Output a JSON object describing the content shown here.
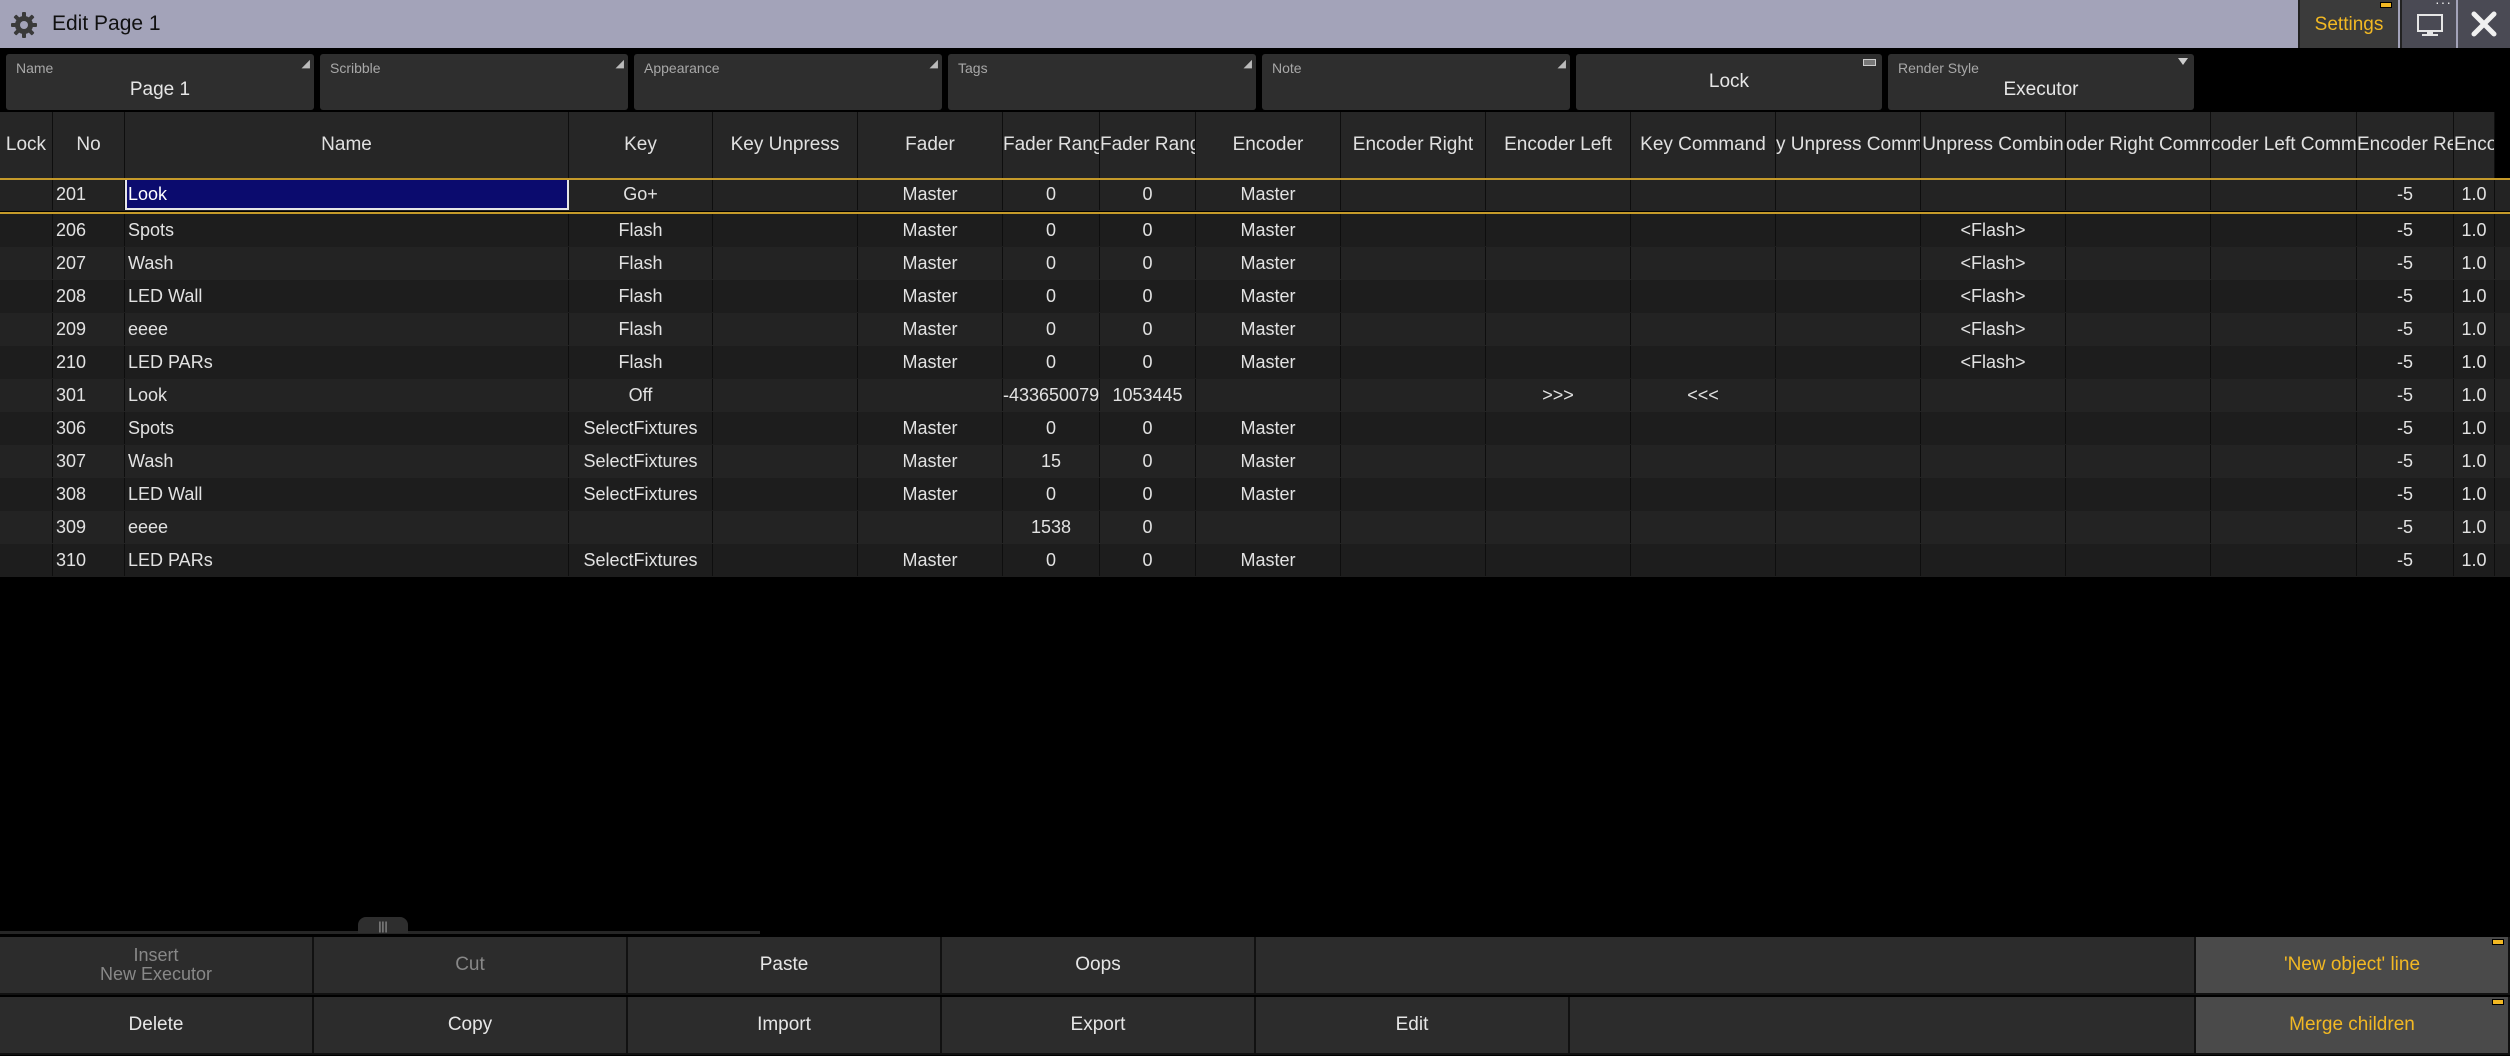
{
  "window": {
    "title": "Edit Page 1",
    "settings_label": "Settings"
  },
  "fields": [
    {
      "label": "Name",
      "value": "Page 1"
    },
    {
      "label": "Scribble",
      "value": ""
    },
    {
      "label": "Appearance",
      "value": ""
    },
    {
      "label": "Tags",
      "value": ""
    },
    {
      "label": "Note",
      "value": ""
    },
    {
      "label": "",
      "value": "Lock"
    },
    {
      "label": "Render Style",
      "value": "Executor"
    }
  ],
  "table": {
    "columns": [
      "Lock",
      "No",
      "Name",
      "Key",
      "Key Unpress",
      "Fader",
      "Fader Range",
      "Fader Range",
      "Encoder",
      "Encoder Right",
      "Encoder Left",
      "Key Command",
      "y Unpress Comma",
      "Unpress Combin",
      "oder Right Comm",
      "coder Left Comma",
      "Encoder Res",
      "Encode"
    ],
    "rows": [
      [
        "",
        "201",
        "Look",
        "Go+",
        "",
        "Master",
        "0",
        "0",
        "Master",
        "",
        "",
        "",
        "",
        "",
        "",
        "",
        "-5",
        "1.0"
      ],
      [
        "",
        "206",
        "Spots",
        "Flash",
        "",
        "Master",
        "0",
        "0",
        "Master",
        "",
        "",
        "",
        "",
        "<Flash>",
        "",
        "",
        "-5",
        "1.0"
      ],
      [
        "",
        "207",
        "Wash",
        "Flash",
        "",
        "Master",
        "0",
        "0",
        "Master",
        "",
        "",
        "",
        "",
        "<Flash>",
        "",
        "",
        "-5",
        "1.0"
      ],
      [
        "",
        "208",
        "LED Wall",
        "Flash",
        "",
        "Master",
        "0",
        "0",
        "Master",
        "",
        "",
        "",
        "",
        "<Flash>",
        "",
        "",
        "-5",
        "1.0"
      ],
      [
        "",
        "209",
        "eeee",
        "Flash",
        "",
        "Master",
        "0",
        "0",
        "Master",
        "",
        "",
        "",
        "",
        "<Flash>",
        "",
        "",
        "-5",
        "1.0"
      ],
      [
        "",
        "210",
        "LED PARs",
        "Flash",
        "",
        "Master",
        "0",
        "0",
        "Master",
        "",
        "",
        "",
        "",
        "<Flash>",
        "",
        "",
        "-5",
        "1.0"
      ],
      [
        "",
        "301",
        "Look",
        "Off",
        "",
        "",
        "-433650079",
        "1053445",
        "",
        "",
        ">>>",
        "<<<",
        "",
        "",
        "",
        "",
        "-5",
        "1.0"
      ],
      [
        "",
        "306",
        "Spots",
        "SelectFixtures",
        "",
        "Master",
        "0",
        "0",
        "Master",
        "",
        "",
        "",
        "",
        "",
        "",
        "",
        "-5",
        "1.0"
      ],
      [
        "",
        "307",
        "Wash",
        "SelectFixtures",
        "",
        "Master",
        "15",
        "0",
        "Master",
        "",
        "",
        "",
        "",
        "",
        "",
        "",
        "-5",
        "1.0"
      ],
      [
        "",
        "308",
        "LED Wall",
        "SelectFixtures",
        "",
        "Master",
        "0",
        "0",
        "Master",
        "",
        "",
        "",
        "",
        "",
        "",
        "",
        "-5",
        "1.0"
      ],
      [
        "",
        "309",
        "eeee",
        "",
        "",
        "",
        "1538",
        "0",
        "",
        "",
        "",
        "",
        "",
        "",
        "",
        "",
        "-5",
        "1.0"
      ],
      [
        "",
        "310",
        "LED PARs",
        "SelectFixtures",
        "",
        "Master",
        "0",
        "0",
        "Master",
        "",
        "",
        "",
        "",
        "",
        "",
        "",
        "-5",
        "1.0"
      ]
    ]
  },
  "buttons": {
    "insert_line1": "Insert",
    "insert_line2": "New Executor",
    "cut": "Cut",
    "paste": "Paste",
    "oops": "Oops",
    "new_object_line": "'New object' line",
    "delete": "Delete",
    "copy": "Copy",
    "import": "Import",
    "export": "Export",
    "edit": "Edit",
    "merge_children": "Merge children"
  },
  "colors": {
    "accent": "#f2b823",
    "titlebar": "#a3a3b9",
    "edit_cell": "#0b0b6e"
  }
}
